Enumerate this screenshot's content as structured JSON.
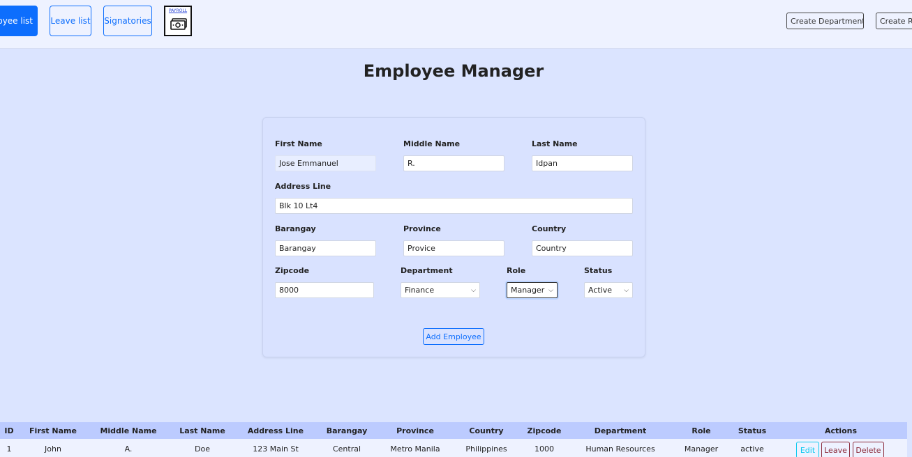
{
  "navbar": {
    "employee_list": "Employee list",
    "leave_list": "Leave list",
    "signatories": "Signatories",
    "payroll_logo_text": "PAYROLL",
    "create_department": "Create Department",
    "create_role": "Create Role"
  },
  "page": {
    "title": "Employee Manager"
  },
  "form": {
    "first_name": {
      "label": "First Name",
      "value": "Jose Emmanuel"
    },
    "middle_name": {
      "label": "Middle Name",
      "value": "R."
    },
    "last_name": {
      "label": "Last Name",
      "value": "Idpan"
    },
    "address_line": {
      "label": "Address Line",
      "value": "Blk 10 Lt4"
    },
    "barangay": {
      "label": "Barangay",
      "placeholder": "Barangay"
    },
    "province": {
      "label": "Province",
      "placeholder": "Provice"
    },
    "country": {
      "label": "Country",
      "placeholder": "Country"
    },
    "zipcode": {
      "label": "Zipcode",
      "value": "8000"
    },
    "department": {
      "label": "Department",
      "value": "Finance"
    },
    "role": {
      "label": "Role",
      "value": "Manager"
    },
    "status": {
      "label": "Status",
      "value": "Active"
    },
    "submit": "Add Employee"
  },
  "table": {
    "headers": [
      "ID",
      "First Name",
      "Middle Name",
      "Last Name",
      "Address Line",
      "Barangay",
      "Province",
      "Country",
      "Zipcode",
      "Department",
      "Role",
      "Status",
      "Actions"
    ],
    "rows": [
      {
        "id": "1",
        "first": "John",
        "middle": "A.",
        "last": "Doe",
        "address": "123 Main St",
        "barangay": "Central",
        "province": "Metro Manila",
        "country": "Philippines",
        "zipcode": "1000",
        "department": "Human Resources",
        "role": "Manager",
        "status": "active"
      }
    ],
    "actions": {
      "edit": "Edit",
      "leave": "Leave",
      "delete": "Delete"
    }
  },
  "colors": {
    "primary": "#0d6efd",
    "info": "#0dcaf0",
    "danger": "#8b2a3a",
    "background": "#dbe4ff",
    "table_header": "#bccbff"
  }
}
